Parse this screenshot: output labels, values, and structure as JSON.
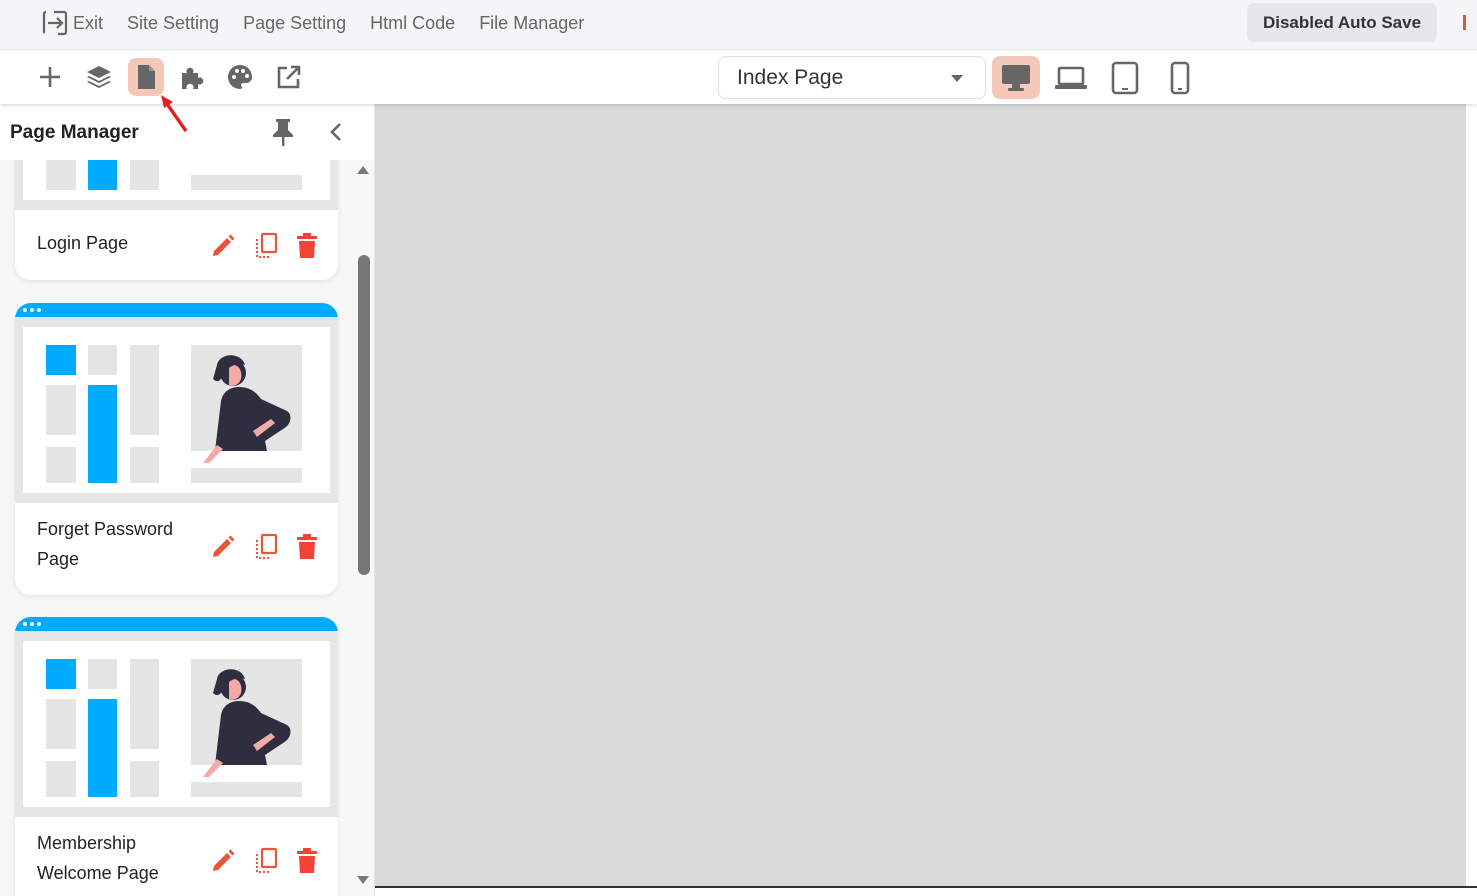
{
  "topbar": {
    "menu": [
      {
        "label": "Exit",
        "icon": "exit-icon"
      },
      {
        "label": "Site Setting"
      },
      {
        "label": "Page Setting"
      },
      {
        "label": "Html Code"
      },
      {
        "label": "File Manager"
      }
    ],
    "autosave_label": "Disabled Auto Save"
  },
  "toolbar": {
    "tools": [
      "plus-icon",
      "layers-icon",
      "page-icon",
      "puzzle-icon",
      "palette-icon",
      "external-link-icon"
    ],
    "active_tool": "page-icon",
    "page_select": {
      "value": "Index Page"
    },
    "devices": [
      "desktop-icon",
      "laptop-icon",
      "tablet-icon",
      "mobile-icon"
    ],
    "active_device": "desktop-icon"
  },
  "sidebar": {
    "title": "Page Manager",
    "pages": [
      {
        "name": "Login Page"
      },
      {
        "name": "Forget Password Page"
      },
      {
        "name": "Membership Welcome Page"
      }
    ]
  },
  "colors": {
    "accent": "#e8553a",
    "active_bg": "#f4c8b9",
    "card_top": "#00aaff",
    "delete": "#f44336",
    "canvas": "#dadada"
  }
}
